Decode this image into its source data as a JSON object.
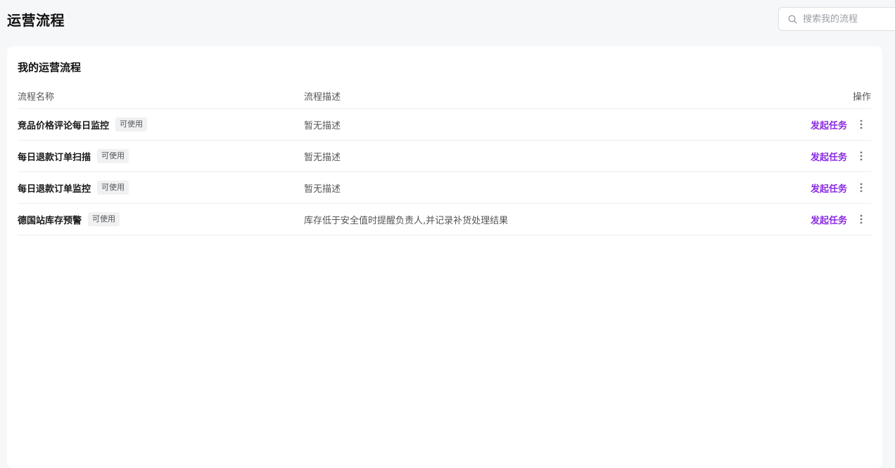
{
  "header": {
    "title": "运营流程",
    "search_placeholder": "搜索我的流程"
  },
  "card": {
    "title": "我的运营流程",
    "columns": {
      "name": "流程名称",
      "description": "流程描述",
      "actions": "操作"
    },
    "rows": [
      {
        "name": "竞品价格评论每日监控",
        "status": "可使用",
        "description": "暂无描述",
        "action": "发起任务"
      },
      {
        "name": "每日退款订单扫描",
        "status": "可使用",
        "description": "暂无描述",
        "action": "发起任务"
      },
      {
        "name": "每日退款订单监控",
        "status": "可使用",
        "description": "暂无描述",
        "action": "发起任务"
      },
      {
        "name": "德国站库存预警",
        "status": "可使用",
        "description": "库存低于安全值时提醒负责人,并记录补货处理结果",
        "action": "发起任务"
      }
    ]
  },
  "colors": {
    "accent": "#8a2be2",
    "background": "#f6f7f9",
    "divider": "#ebedf0"
  },
  "icons": {
    "search": "search-icon",
    "more": "more-vertical-icon"
  }
}
